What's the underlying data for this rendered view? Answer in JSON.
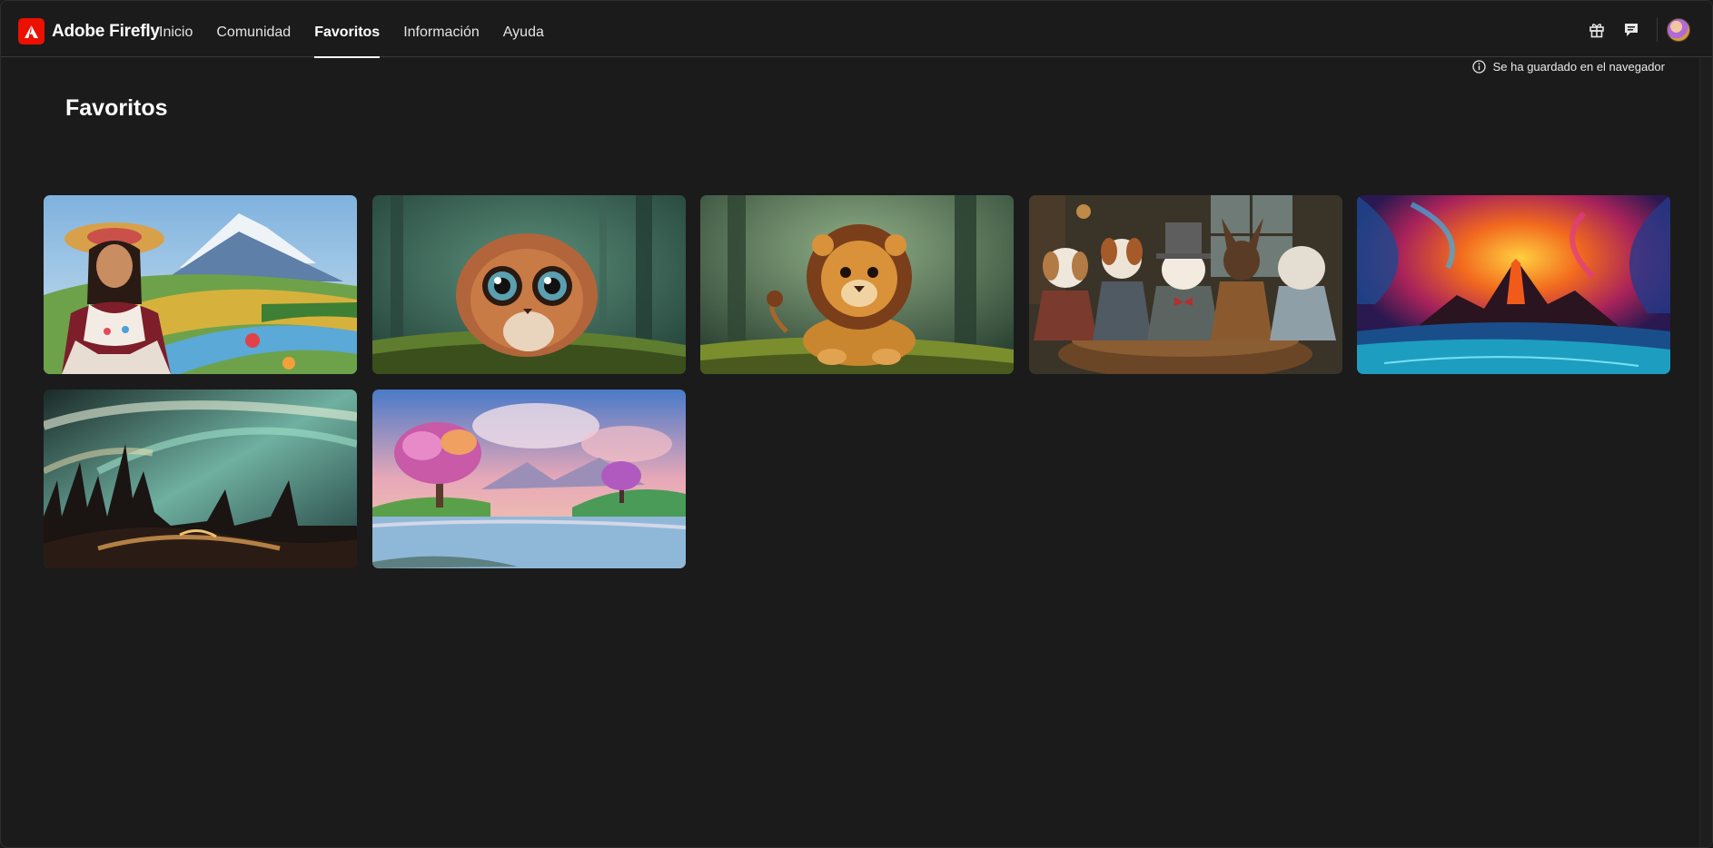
{
  "app": {
    "brand_name": "Adobe Firefly",
    "brand_color": "#eb1000"
  },
  "nav": {
    "tabs": [
      {
        "label": "Inicio",
        "active": false
      },
      {
        "label": "Comunidad",
        "active": false
      },
      {
        "label": "Favoritos",
        "active": true
      },
      {
        "label": "Información",
        "active": false
      },
      {
        "label": "Ayuda",
        "active": false
      }
    ],
    "right_icons": [
      "gift-icon",
      "chat-icon",
      "avatar"
    ]
  },
  "notice": {
    "icon": "info-icon",
    "text": "Se ha guardado en el navegador"
  },
  "page": {
    "title": "Favoritos"
  },
  "gallery": {
    "images": [
      {
        "subject": "woman-in-traditional-dress-by-river-and-volcano"
      },
      {
        "subject": "fluffy-big-eyed-creature-in-forest"
      },
      {
        "subject": "cartoon-lion-cub-in-forest"
      },
      {
        "subject": "dogs-playing-cards-at-table"
      },
      {
        "subject": "colorful-volcanic-fantasy-landscape"
      },
      {
        "subject": "dark-spired-landscape-with-aurora-sky"
      },
      {
        "subject": "pink-tree-by-lake-fantasy-landscape"
      }
    ]
  }
}
